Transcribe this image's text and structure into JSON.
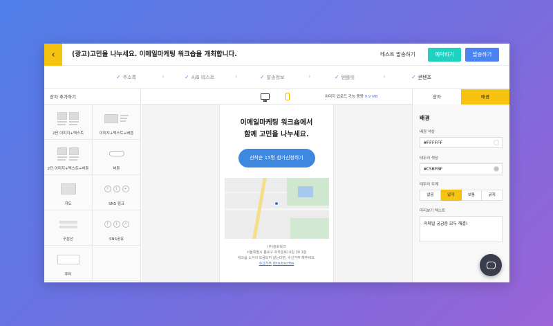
{
  "header": {
    "back_icon": "chevron-left",
    "title": "(광고)고민을 나누세요. 이메일마케팅 워크숍을 개최합니다.",
    "test_send": "테스트 발송하기",
    "reserve": "예약하기",
    "send": "발송하기"
  },
  "steps": [
    "주소록",
    "A/B 테스트",
    "발송정보",
    "템플릿",
    "콘텐츠"
  ],
  "left_panel": {
    "title": "상자 추가하기",
    "blocks": [
      "2단 이미지+텍스트",
      "이미지+텍스트+버튼",
      "2단 이미지+텍스트+버튼",
      "버튼",
      "지도",
      "SNS 링크",
      "구분선",
      "SNS공유",
      "푸터"
    ]
  },
  "toolbar": {
    "upload_label": "이미지 업로드 가능 용량",
    "upload_value": "9.9 MB"
  },
  "email": {
    "title_line1": "이메일마케팅 워크숍에서",
    "title_line2": "함께 고민을 나누세요.",
    "cta": "선착순 15명 참가신청하기",
    "company": "(주)슬로워크",
    "address": "서울특별시 종로구 자하문로10길 30 3층",
    "notice": "워크숍 소식이 도움되지 않는다면, 수신거부 해주세요.",
    "unsub_ko": "수신거부",
    "unsub_en": "Unsubscribe"
  },
  "right_panel": {
    "tabs": [
      "상자",
      "배경"
    ],
    "section_title": "배경",
    "bg_color_label": "배경 색상",
    "bg_color": "#FFFFFF",
    "border_color_label": "테두리 색상",
    "border_color": "#C5BFBF",
    "border_width_label": "테두리 두께",
    "border_widths": [
      "없음",
      "얇게",
      "보통",
      "굵게"
    ],
    "preview_label": "미리보기 텍스트",
    "preview_text": "이메일 궁금증 모두 해결!"
  },
  "colors": {
    "accent": "#F7C311",
    "reserve": "#1FD1C1",
    "send": "#4B83F2",
    "check": "#4B83F2"
  }
}
